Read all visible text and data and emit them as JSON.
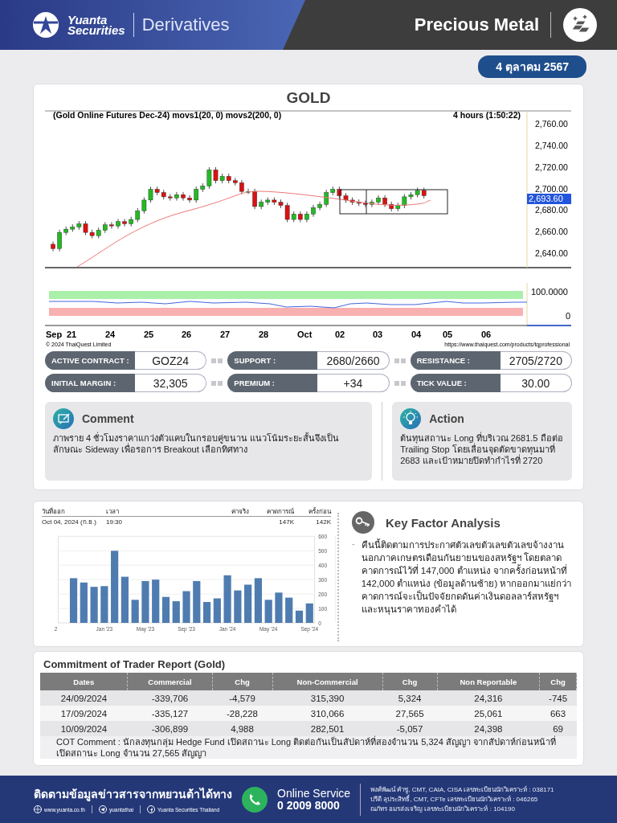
{
  "header": {
    "brand_top": "Yuanta",
    "brand_bottom": "Securities",
    "section": "Derivatives",
    "title": "Precious Metal"
  },
  "date": "4 ตุลาคม 2567",
  "price_chart": {
    "title": "GOLD",
    "caption": "(Gold Online Futures Dec-24) movs1(20, 0) movs2(200, 0)",
    "interval": "4 hours (1:50:22)",
    "price_ticks": [
      "2,760.00",
      "2,740.00",
      "2,720.00",
      "2,700.00",
      "2,680.00",
      "2,660.00",
      "2,640.00"
    ],
    "last_price": "2,693.60",
    "indicator_ticks": [
      "100.0000",
      "0"
    ],
    "date_labels": [
      "Sep",
      "21",
      "24",
      "25",
      "26",
      "27",
      "28",
      "Oct",
      "02",
      "03",
      "04",
      "05",
      "06"
    ],
    "copyright": "© 2024 ThaiQuest Limited",
    "source_url": "https://www.thaiquest.com/products/tqprofessional"
  },
  "contract_info": [
    {
      "label": "ACTIVE CONTRACT :",
      "value": "GOZ24"
    },
    {
      "label": "SUPPORT :",
      "value": "2680/2660"
    },
    {
      "label": "RESISTANCE :",
      "value": "2705/2720"
    },
    {
      "label": "INITIAL MARGIN :",
      "value": "32,305"
    },
    {
      "label": "PREMIUM :",
      "value": "+34"
    },
    {
      "label": "TICK VALUE :",
      "value": "30.00"
    }
  ],
  "comment": {
    "title": "Comment",
    "text": "ภาพราย 4 ชั่วโมงราคาแกว่งตัวแคบในกรอบคู่ขนาน แนวโน้มระยะสั้นจึงเป็นลักษณะ Sideway เพื่อรอการ Breakout เลือกทิศทาง"
  },
  "action": {
    "title": "Action",
    "text": "ต้นทุนสถานะ Long ที่บริเวณ 2681.5 ถือต่อ Trailing Stop โดยเลื่อนจุดตัดขาดทุนมาที่ 2683 และเป้าหมายปิดทำกำไรที่ 2720"
  },
  "economic_calendar": {
    "columns": [
      "วันที่ออก",
      "เวลา",
      "ค่าจริง",
      "คาดการณ์",
      "ครั้งก่อน"
    ],
    "row": {
      "date": "Oct 04, 2024 (ก.ย.)",
      "time": "19:30",
      "forecast": "147K",
      "previous": "142K"
    },
    "chart_data": {
      "type": "bar",
      "categories": [
        "2",
        null,
        null,
        null,
        "Jan '23",
        null,
        null,
        null,
        "May '23",
        null,
        null,
        null,
        "Sep '23",
        null,
        null,
        null,
        "Jan '24",
        null,
        null,
        null,
        "May '24",
        null,
        null,
        null,
        "Sep '24"
      ],
      "series": [
        {
          "color": "#4f7cb0",
          "values": [
            null,
            310,
            280,
            250,
            255,
            500,
            320,
            160,
            290,
            300,
            180,
            150,
            220,
            290,
            145,
            170,
            330,
            225,
            265,
            310,
            160,
            210,
            175,
            85,
            135
          ]
        }
      ],
      "ylim": [
        0,
        600
      ],
      "yticks": [
        0,
        100,
        200,
        300,
        400,
        500,
        600
      ],
      "grid": true
    }
  },
  "key_factor": {
    "title": "Key Factor Analysis",
    "bullet": "-",
    "text": "คืนนี้ติดตามการประกาศตัวเลขตัวเลขตัวเลขจ้างงานนอกภาคเกษตรเดือนกันยายนของสหรัฐฯ โดยตลาดคาดการณ์ไว้ที่ 147,000 ตำแหน่ง จากครั้งก่อนหน้าที่ 142,000 ตำแหน่ง (ข้อมูลด้านซ้าย) หากออกมาแย่กว่าคาดการณ์จะเป็นปัจจัยกดดันค่าเงินดอลลาร์สหรัฐฯ และหนุนราคาทองคำได้"
  },
  "cot": {
    "title": "Commitment of Trader Report (Gold)",
    "columns": [
      "Dates",
      "Commercial",
      "Chg",
      "Non-Commercial",
      "Chg",
      "Non Reportable",
      "Chg"
    ],
    "rows": [
      [
        "24/09/2024",
        "-339,706",
        "-4,579",
        "315,390",
        "5,324",
        "24,316",
        "-745"
      ],
      [
        "17/09/2024",
        "-335,127",
        "-28,228",
        "310,066",
        "27,565",
        "25,061",
        "663"
      ],
      [
        "10/09/2024",
        "-306,899",
        "4,988",
        "282,501",
        "-5,057",
        "24,398",
        "69"
      ]
    ],
    "comment": "COT Comment : นักลงทุนกลุ่ม Hedge Fund เปิดสถานะ Long ติดต่อกันเป็นสัปดาห์ที่สองจำนวน 5,324 สัญญา จากสัปดาห์ก่อนหน้าที่เปิดสถานะ Long จำนวน 27,565 สัญญา"
  },
  "footer": {
    "heading": "ติดตามข้อมูลข่าวสารจากหยวนต้าได้ทาง",
    "links": [
      {
        "kind": "web",
        "text": "www.yuanta.co.th"
      },
      {
        "kind": "telegram",
        "text": "yuantathai"
      },
      {
        "kind": "facebook",
        "text": "Yuanta Securities Thailand"
      }
    ],
    "service_label": "Online Service",
    "phone": "0 2009 8000",
    "analysts": [
      "พงศ์พัฒน์ คำชู, CMT, CAIA, CISA เลขทะเบียนนักวิเคราะห์ : 038171",
      "ปรีดี ลุประสิทธิ์, CMT, CFTe เลขทะเบียนนักวิเคราะห์ : 046265",
      "ณภัทร อมรส่งเจริญ  เลขทะเบียนนักวิเคราะห์ : 104190"
    ]
  }
}
